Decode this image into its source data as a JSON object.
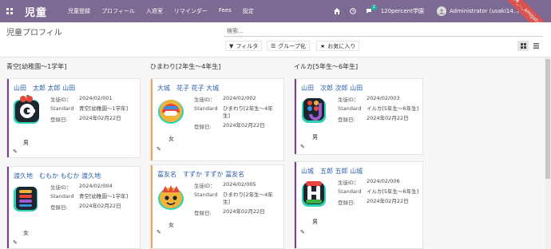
{
  "navbar": {
    "app_title": "児童",
    "menu": [
      "児童登録",
      "プロフィール",
      "入退室",
      "リマインダー",
      "Fees",
      "設定"
    ],
    "chat_count": "2",
    "company": "120percent学園",
    "user": "Administrator (usaki14..)",
    "ribbon": "(usaki14_..._amigatuidaisaito)"
  },
  "control": {
    "page_title": "児童プロフィル",
    "search_placeholder": "検索...",
    "filter_label": "フィルタ",
    "group_label": "グループ化",
    "favorite_label": "お気に入り"
  },
  "columns": [
    {
      "title": "青空[幼稚園〜1学年]",
      "cards": [
        {
          "name": "山田　太郎 太郎 山田",
          "id_label": "生徒ID：",
          "id": "2024/02/001",
          "standard_label": "Standard",
          "standard": "青空[幼稚園〜1学年]",
          "date_label": "登録日:",
          "date": "2024年02月22日",
          "gender": "男",
          "stripe": "#7b3e8c"
        },
        {
          "name": "渡久地　むもか もむか 渡久地",
          "id_label": "生徒ID：",
          "id": "2024/02/004",
          "standard_label": "Standard",
          "standard": "青空[幼稚園〜1学年]",
          "date_label": "登録日:",
          "date": "2024年02月22日",
          "gender": "女",
          "stripe": "#7b3e8c"
        }
      ]
    },
    {
      "title": "ひまわり[2年生〜4年生]",
      "cards": [
        {
          "name": "大城　花子 花子 大城",
          "id_label": "生徒ID：",
          "id": "2024/02/002",
          "standard_label": "Standard",
          "standard": "ひまわり[2年生〜4年生]",
          "date_label": "登録日:",
          "date": "2024年02月22日",
          "gender": "女",
          "stripe": "#f0a35e"
        },
        {
          "name": "冨友名　すずか すずか 冨友名",
          "id_label": "生徒ID：",
          "id": "2024/02/005",
          "standard_label": "Standard",
          "standard": "ひまわり[2年生〜4年生]",
          "date_label": "登録日:",
          "date": "2024年02月22日",
          "gender": "女",
          "stripe": "#f0a35e"
        }
      ]
    },
    {
      "title": "イルカ[5年生〜6年生]",
      "cards": [
        {
          "name": "山田　次郎 次郎 山田",
          "id_label": "生徒ID：",
          "id": "2024/02/003",
          "standard_label": "Standard",
          "standard": "イルカ[5年生〜6年生]",
          "date_label": "登録日:",
          "date": "2024年02月22日",
          "gender": "男",
          "stripe": "#7b3e8c"
        },
        {
          "name": "山城　五郎 五郎 山城",
          "id_label": "生徒ID：",
          "id": "2024/02/006",
          "standard_label": "Standard",
          "standard": "イルカ[5年生〜6年生]",
          "date_label": "登録日:",
          "date": "2024年02月22日",
          "gender": "男",
          "stripe": "#7b3e8c"
        }
      ]
    }
  ]
}
